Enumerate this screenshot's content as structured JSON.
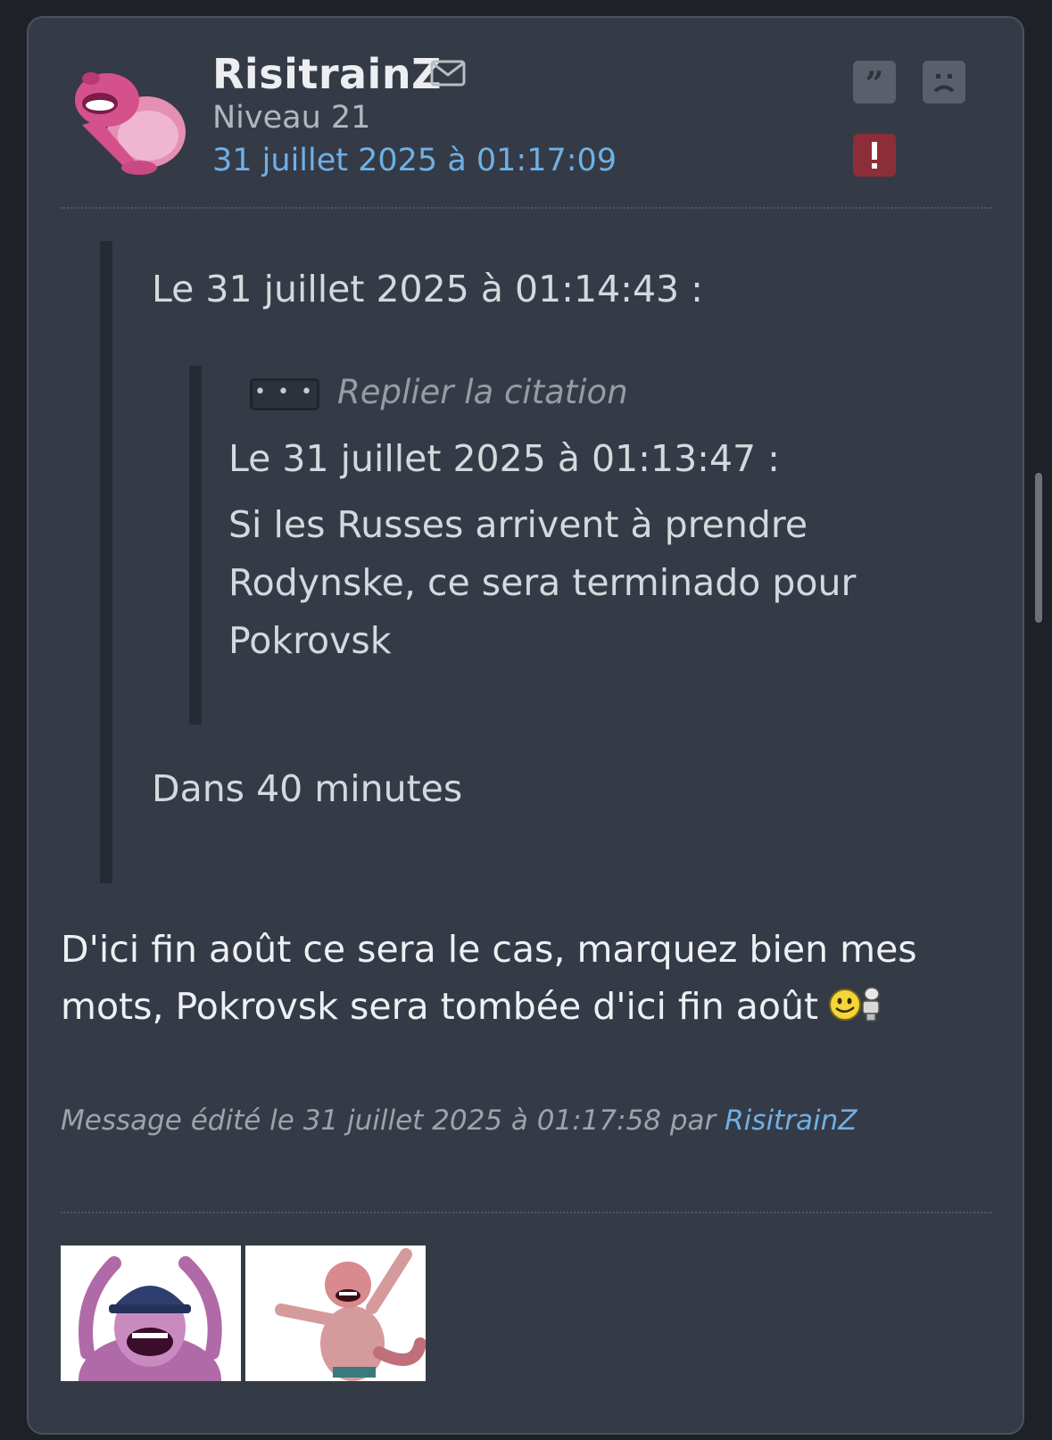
{
  "post": {
    "author": "RisitrainZ",
    "level": "Niveau 21",
    "date": "31 juillet 2025 à 01:17:09",
    "actions": {
      "quote_icon": "quote-icon",
      "sad_icon": "sad-face-icon",
      "report_icon": "report-icon",
      "mail_icon": "mail-icon"
    },
    "quote": {
      "header": "Le 31 juillet 2025 à 01:14:43 :",
      "nested": {
        "fold_label": "Replier la citation",
        "fold_button": "• • •",
        "header": "Le 31 juillet 2025 à 01:13:47 :",
        "text": "Si les Russes arrivent à prendre Rodynske, ce sera terminado pour Pokrovsk"
      },
      "reply": "Dans 40 minutes"
    },
    "body": "D'ici fin août ce sera le cas, marquez bien mes mots, Pokrovsk sera tombée d'ici fin août",
    "edit": {
      "prefix": "Message édité le 31 juillet 2025 à 01:17:58 par ",
      "by": "RisitrainZ"
    }
  },
  "colors": {
    "background": "#1e2128",
    "card": "#353b46",
    "link": "#6fb0e6",
    "report": "#8c2e37"
  }
}
